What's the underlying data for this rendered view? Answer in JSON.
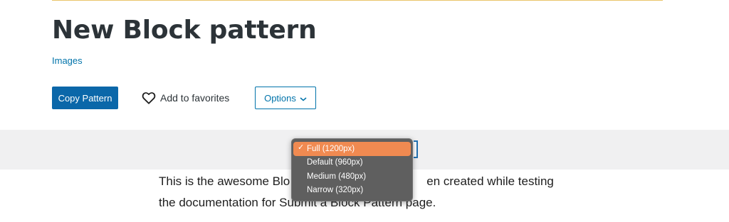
{
  "pattern": {
    "title": "New Block pattern",
    "category": "Images"
  },
  "actions": {
    "copy_label": "Copy Pattern",
    "favorite_label": "Add to favorites",
    "options_label": "Options"
  },
  "preview": {
    "width_select": {
      "selected": "Full (1200px)",
      "options": [
        "Full (1200px)",
        "Default (960px)",
        "Medium (480px)",
        "Narrow (320px)"
      ]
    },
    "content_lines": [
      "This is the awesome Blo",
      "en created while testing",
      "the documentation for Submit a Block Pattern page."
    ]
  },
  "colors": {
    "accent": "#0b67a9",
    "link": "#0073aa",
    "menu_highlight": "#f08a51",
    "menu_bg": "#5f5f5f"
  },
  "icons": {
    "favorite": "heart-outline-icon",
    "options": "chevron-down-icon",
    "selected": "checkmark-icon"
  }
}
